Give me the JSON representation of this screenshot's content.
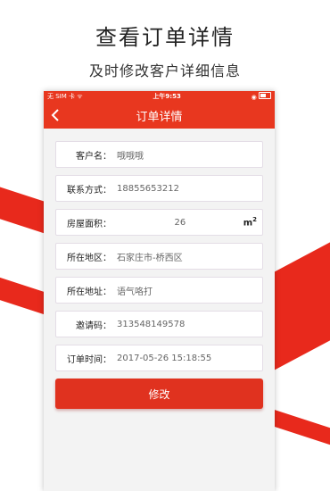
{
  "hero": {
    "title": "查看订单详情",
    "subtitle": "及时修改客户详细信息"
  },
  "status_bar": {
    "carrier": "无 SIM 卡 ᯤ",
    "time": "上午9:53",
    "icons": "◉"
  },
  "nav": {
    "title": "订单详情",
    "back_icon": "chevron-left-icon"
  },
  "form": {
    "fields": [
      {
        "label": "客户名：",
        "value": "哦哦哦"
      },
      {
        "label": "联系方式：",
        "value": "18855653212"
      },
      {
        "label": "房屋面积：",
        "value": "26",
        "unit": "m",
        "unit_sup": "2"
      },
      {
        "label": "所在地区：",
        "value": "石家庄市-桥西区"
      },
      {
        "label": "所在地址：",
        "value": "语气咯打"
      },
      {
        "label": "邀请码：",
        "value": "313548149578"
      },
      {
        "label": "订单时间：",
        "value": "2017-05-26 15:18:55"
      }
    ],
    "submit_label": "修改"
  },
  "colors": {
    "accent": "#e8371f",
    "button": "#e0321f"
  }
}
